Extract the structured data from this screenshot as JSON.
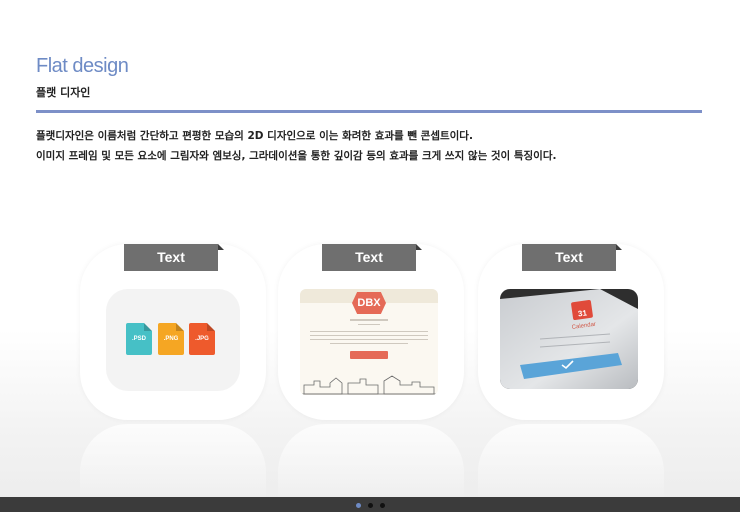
{
  "header": {
    "title": "Flat design",
    "subtitle": "플랫 디자인"
  },
  "description": {
    "line1": "플랫디자인은 이름처럼 간단하고 편평한 모습의 2D 디자인으로 이는 화려한 효과를 뺀 콘셉트이다.",
    "line2": "이미지 프레임 및 모든 요소에 그림자와 엠보싱, 그라데이션을 통한 깊이감 등의 효과를 크게 쓰지 않는 것이 특징이다."
  },
  "cards": [
    {
      "label": "Text",
      "files": [
        {
          "ext": ".PSD",
          "color": "#46c0c6"
        },
        {
          "ext": ".PNG",
          "color": "#f5a623"
        },
        {
          "ext": ".JPG",
          "color": "#ee5a2c"
        }
      ]
    },
    {
      "label": "Text",
      "logo": "DBX"
    },
    {
      "label": "Text",
      "calendar_day": "31",
      "calendar_label": "Calendar"
    }
  ],
  "pager": {
    "count": 3,
    "active_index": 0
  },
  "colors": {
    "accent": "#6e8bc5",
    "tab": "#6f6f6f",
    "bottom_bar": "#3b3b3b"
  }
}
